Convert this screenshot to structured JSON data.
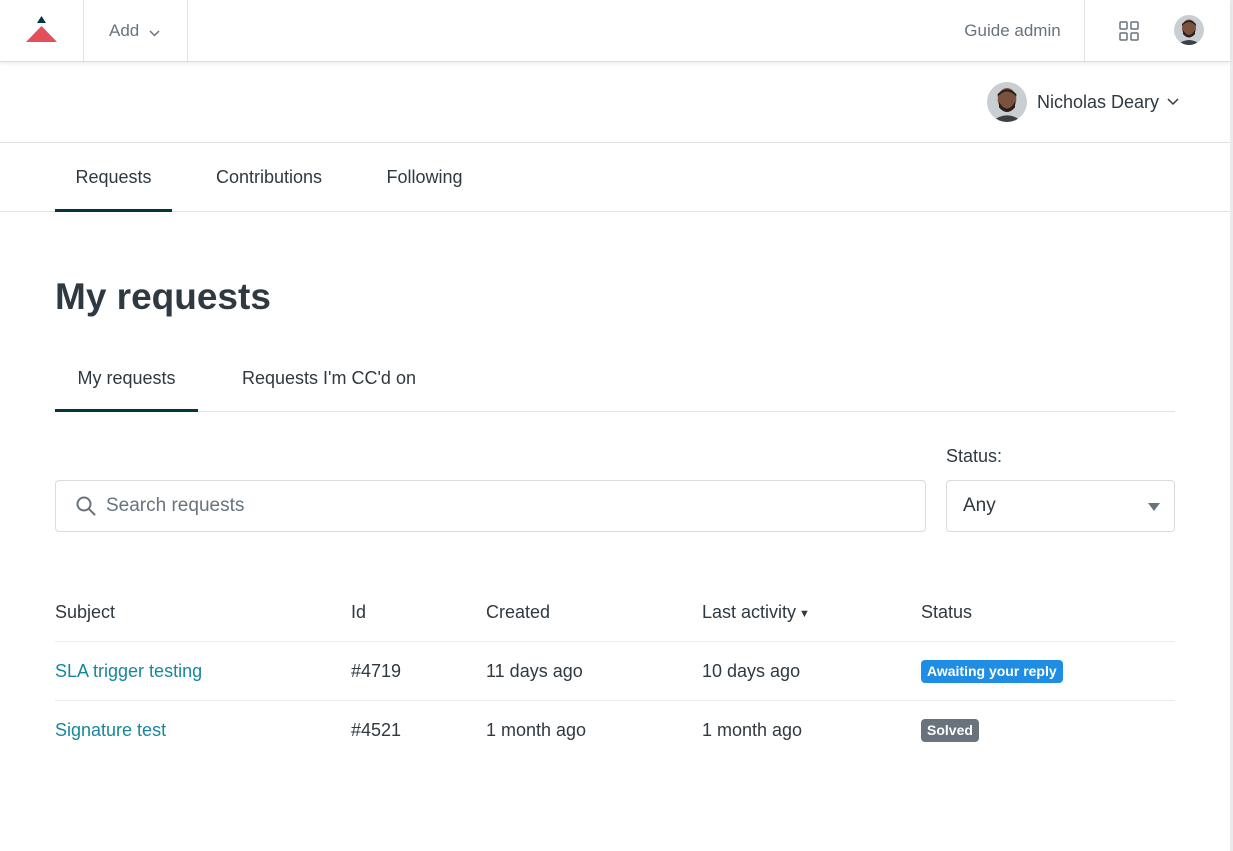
{
  "topbar": {
    "add_label": "Add",
    "guide_admin_label": "Guide admin",
    "icons": {
      "logo": "brand-triangle-logo",
      "add_chevron": "chevron-down-icon",
      "apps": "app-grid-icon",
      "avatar": "avatar"
    }
  },
  "user": {
    "name": "Nicholas Deary"
  },
  "profile_tabs": [
    {
      "label": "Requests",
      "active": true
    },
    {
      "label": "Contributions",
      "active": false
    },
    {
      "label": "Following",
      "active": false
    }
  ],
  "page": {
    "title": "My requests"
  },
  "sub_tabs": [
    {
      "label": "My requests",
      "active": true
    },
    {
      "label": "Requests I'm CC'd on",
      "active": false
    }
  ],
  "search": {
    "placeholder": "Search requests",
    "value": ""
  },
  "status_filter": {
    "label": "Status:",
    "selected": "Any"
  },
  "table": {
    "headers": {
      "subject": "Subject",
      "id": "Id",
      "created": "Created",
      "last_activity": "Last activity",
      "status": "Status"
    },
    "sort_indicator": "▼",
    "rows": [
      {
        "subject": "SLA trigger testing",
        "id": "#4719",
        "created": "11 days ago",
        "last_activity": "10 days ago",
        "status": "Awaiting your reply",
        "status_color": "#1f8de3"
      },
      {
        "subject": "Signature test",
        "id": "#4521",
        "created": "1 month ago",
        "last_activity": "1 month ago",
        "status": "Solved",
        "status_color": "#68737d"
      }
    ]
  },
  "colors": {
    "link": "#17879b",
    "tab_underline": "#03363d",
    "logo_red": "#e34f5b",
    "logo_dark": "#03363d"
  }
}
